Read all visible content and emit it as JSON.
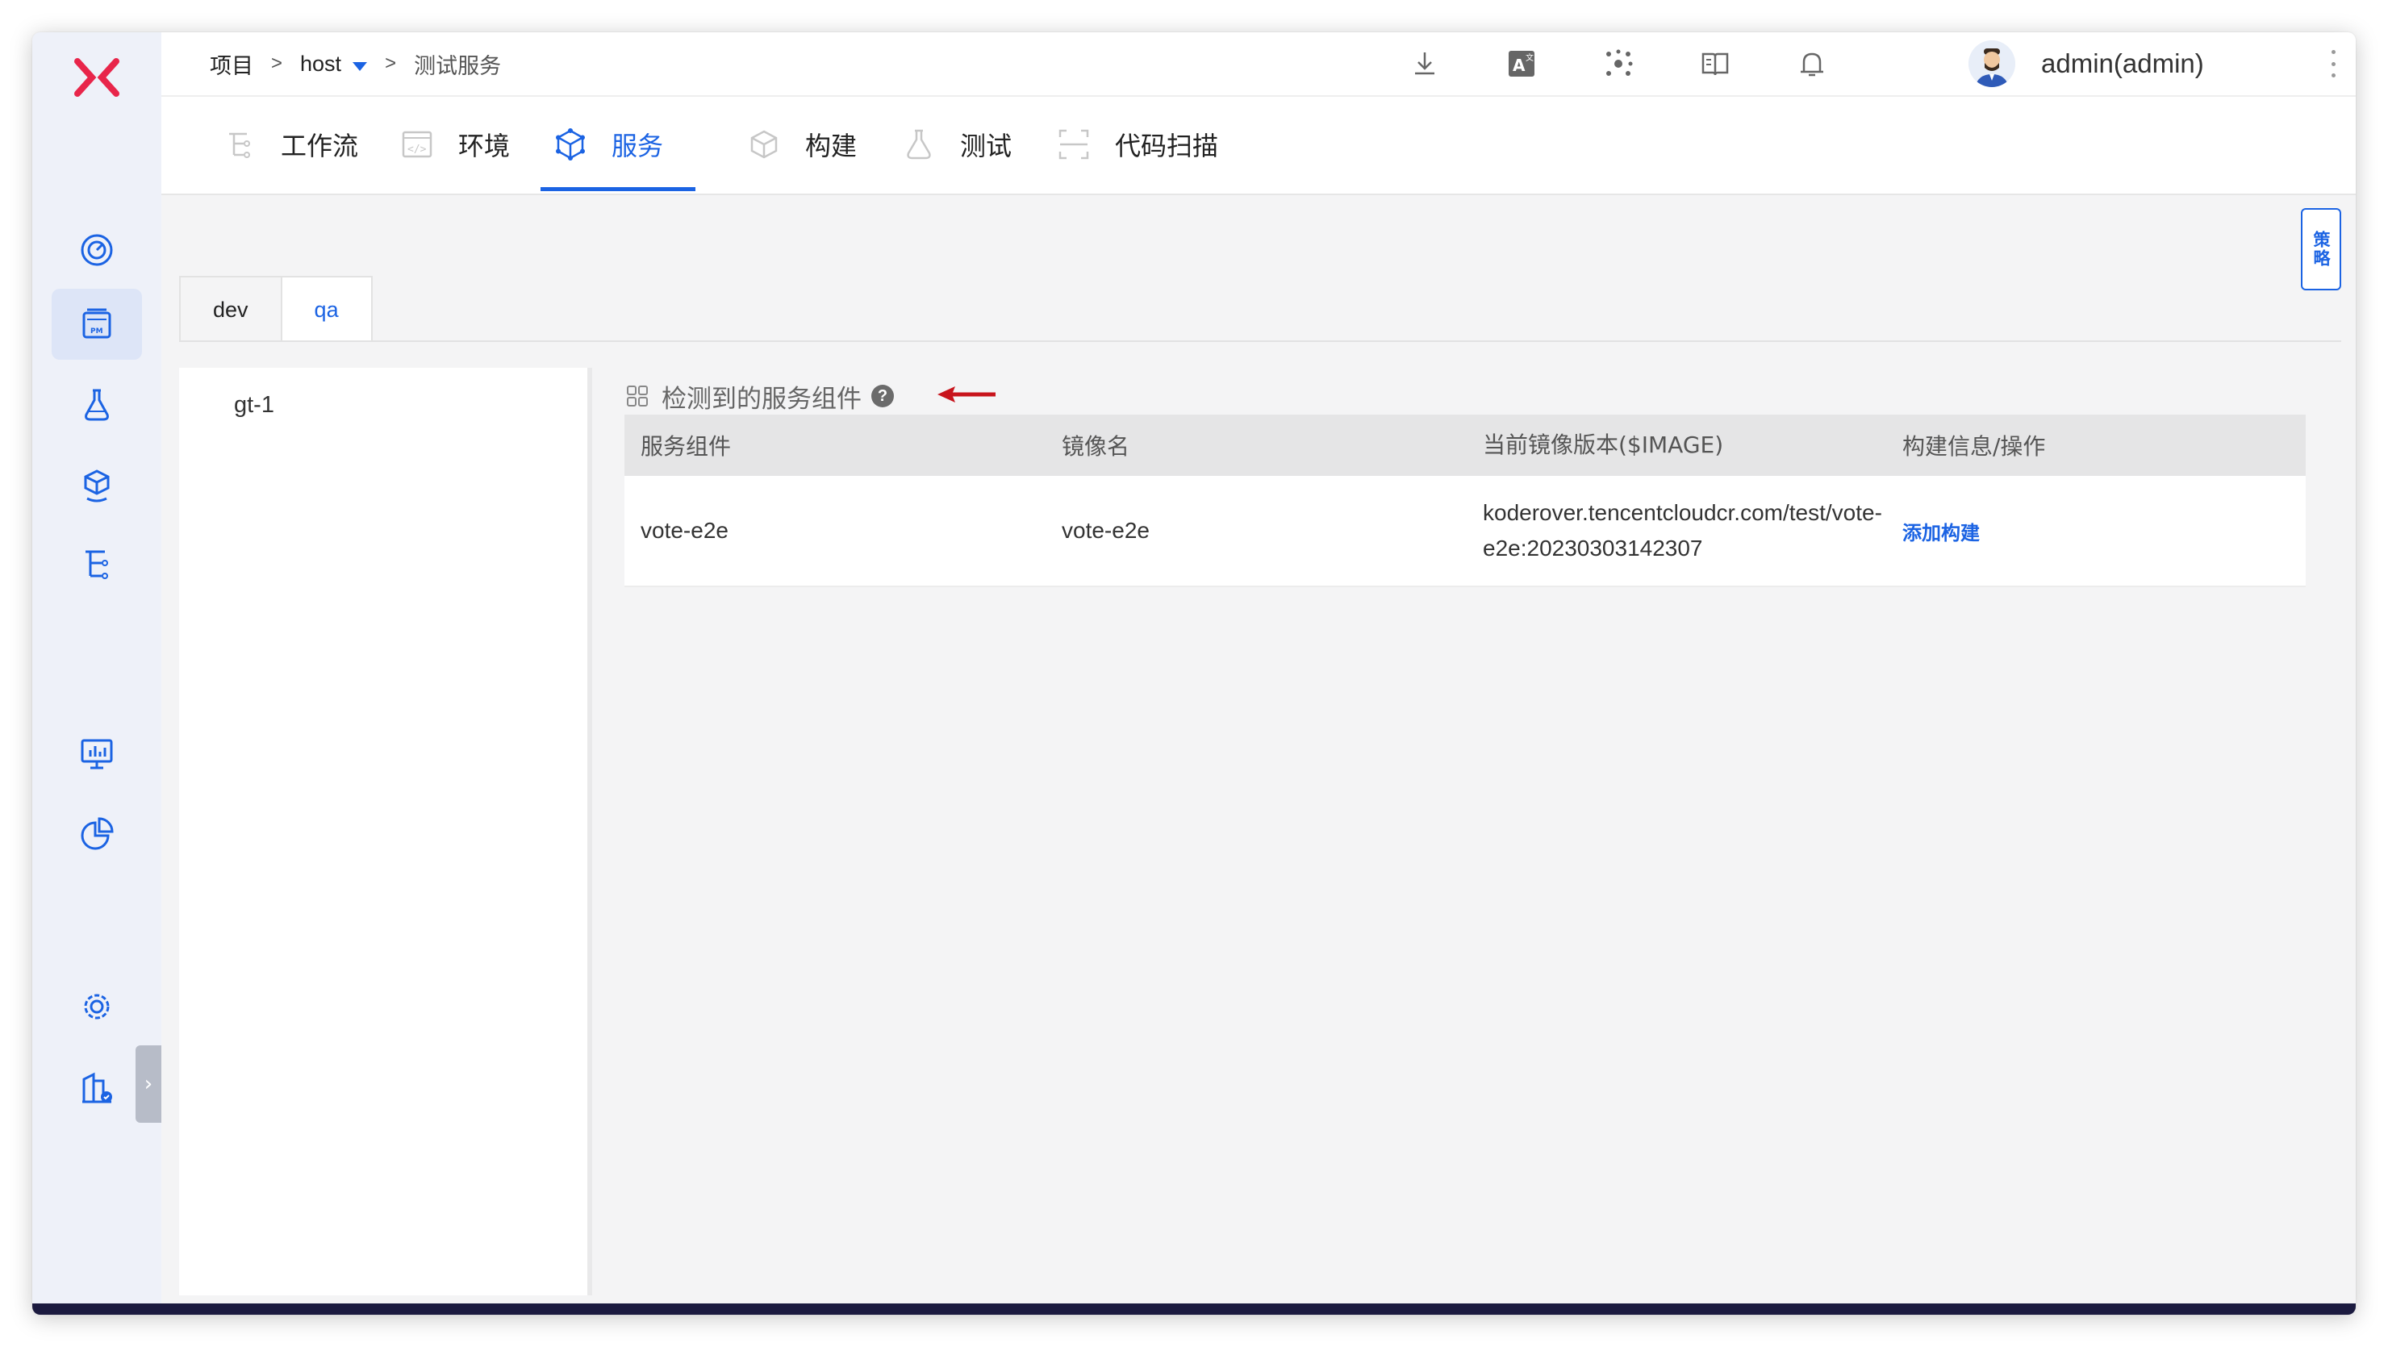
{
  "breadcrumb": {
    "project": "项目",
    "sep1": ">",
    "project_name": "host",
    "sep2": ">",
    "current": "测试服务"
  },
  "header": {
    "username": "admin(admin)",
    "icons": [
      "download-icon",
      "translate-icon",
      "network-icon",
      "docs-icon",
      "bell-icon"
    ]
  },
  "nav": {
    "tabs": [
      {
        "label": "工作流",
        "icon": "workflow-icon"
      },
      {
        "label": "环境",
        "icon": "environment-icon"
      },
      {
        "label": "服务",
        "icon": "service-icon",
        "active": true
      },
      {
        "label": "构建",
        "icon": "build-icon"
      },
      {
        "label": "测试",
        "icon": "test-icon"
      },
      {
        "label": "代码扫描",
        "icon": "code-scan-icon"
      }
    ]
  },
  "strategy_button": "策略",
  "env_tabs": [
    {
      "label": "dev"
    },
    {
      "label": "qa",
      "active": true
    }
  ],
  "services": [
    {
      "name": "gt-1"
    }
  ],
  "section": {
    "title": "检测到的服务组件",
    "help": "?"
  },
  "table": {
    "headers": [
      "服务组件",
      "镜像名",
      "当前镜像版本($IMAGE)",
      "构建信息/操作"
    ],
    "rows": [
      {
        "component": "vote-e2e",
        "image_name": "vote-e2e",
        "image_version": "koderover.tencentcloudcr.com/test/vote-e2e:20230303142307",
        "action": "添加构建"
      }
    ]
  },
  "colors": {
    "accent": "#1b63e3",
    "logo": "#e8254a",
    "sidebar_bg": "#eef1f9"
  }
}
